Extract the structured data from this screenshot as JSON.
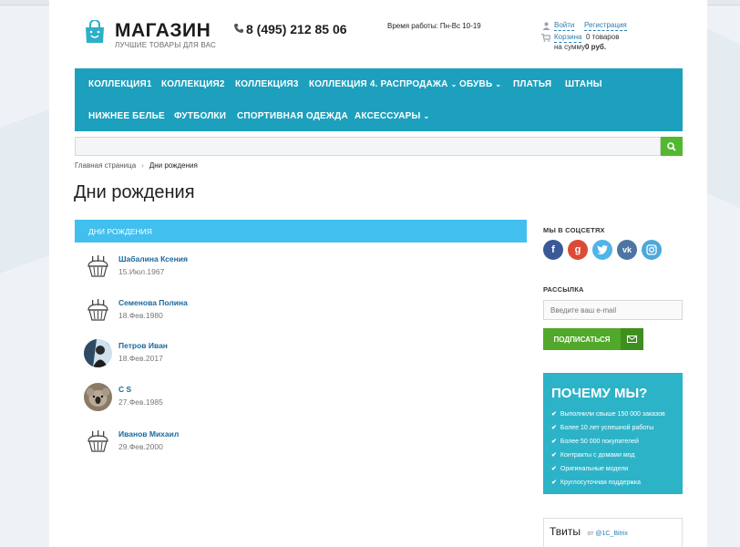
{
  "header": {
    "logo_title": "МАГАЗИН",
    "logo_subtitle": "ЛУЧШИЕ ТОВАРЫ ДЛЯ ВАС",
    "phone": "8 (495) 212 85 06",
    "working_hours": "Время работы: Пн-Вс 10-19",
    "login": "Войти",
    "register": "Регистрация",
    "cart_label": "Корзина",
    "cart_count": "0 товаров",
    "cart_sum_prefix": "на сумму",
    "cart_sum": "0 руб."
  },
  "nav": {
    "items": [
      {
        "label": "КОЛЛЕКЦИЯ1",
        "dropdown": false
      },
      {
        "label": "КОЛЛЕКЦИЯ2",
        "dropdown": false
      },
      {
        "label": "КОЛЛЕКЦИЯ3",
        "dropdown": false
      },
      {
        "label": "КОЛЛЕКЦИЯ 4. РАСПРОДАЖА",
        "dropdown": true
      },
      {
        "label": "ОБУВЬ",
        "dropdown": true
      },
      {
        "label": "ПЛАТЬЯ",
        "dropdown": false
      },
      {
        "label": "ШТАНЫ",
        "dropdown": false
      },
      {
        "label": "НИЖНЕЕ БЕЛЬЕ",
        "dropdown": false
      },
      {
        "label": "ФУТБОЛКИ",
        "dropdown": false
      },
      {
        "label": "СПОРТИВНАЯ ОДЕЖДА",
        "dropdown": false
      },
      {
        "label": "АКСЕССУАРЫ",
        "dropdown": true
      }
    ]
  },
  "breadcrumb": {
    "home": "Главная страница",
    "separator": "›",
    "current": "Дни рождения"
  },
  "page_title": "Дни рождения",
  "birthdays": {
    "header": "ДНИ РОЖДЕНИЯ",
    "people": [
      {
        "name": "Шабалина Ксения",
        "date": "15.Июл.1967",
        "avatar": "cupcake-icon"
      },
      {
        "name": "Семенова Полина",
        "date": "18.Фев.1980",
        "avatar": "cupcake-icon"
      },
      {
        "name": "Петров Иван",
        "date": "18.Фев.2017",
        "avatar": "photo"
      },
      {
        "name": "C S",
        "date": "27.Фев.1985",
        "avatar": "photo"
      },
      {
        "name": "Иванов Михаил",
        "date": "29.Фев.2000",
        "avatar": "cupcake-icon"
      }
    ]
  },
  "sidebar": {
    "social_heading": "МЫ В СОЦСЕТЯХ",
    "social": [
      {
        "name": "facebook-icon",
        "glyph": "f",
        "color": "#3b5998"
      },
      {
        "name": "google-plus-icon",
        "glyph": "g",
        "color": "#dc4a38"
      },
      {
        "name": "twitter-icon",
        "glyph": "t",
        "color": "#4fb4e8"
      },
      {
        "name": "vk-icon",
        "glyph": "vk",
        "color": "#4c75a3"
      },
      {
        "name": "instagram-icon",
        "glyph": "◎",
        "color": "#4ba8dc"
      }
    ],
    "newsletter_heading": "РАССЫЛКА",
    "email_placeholder": "Введите ваш e-mail",
    "subscribe_label": "ПОДПИСАТЬСЯ",
    "why_title": "ПОЧЕМУ МЫ?",
    "why_items": [
      "Выполнили свыше 150 000 заказов",
      "Более 10 лет успешной работы",
      "Более 50 000 покупателей",
      "Контракты с домами мод",
      "Оригинальные модели",
      "Круглосуточная поддержка"
    ],
    "tweets_title": "Твиты",
    "tweets_from": "от",
    "tweets_handle": "@1C_Bitrix"
  },
  "colors": {
    "nav_bg": "#1da0be",
    "list_header": "#41bfef",
    "green_button": "#52a82a",
    "why_bg": "#2db3c7",
    "link": "#1a6a9c"
  }
}
